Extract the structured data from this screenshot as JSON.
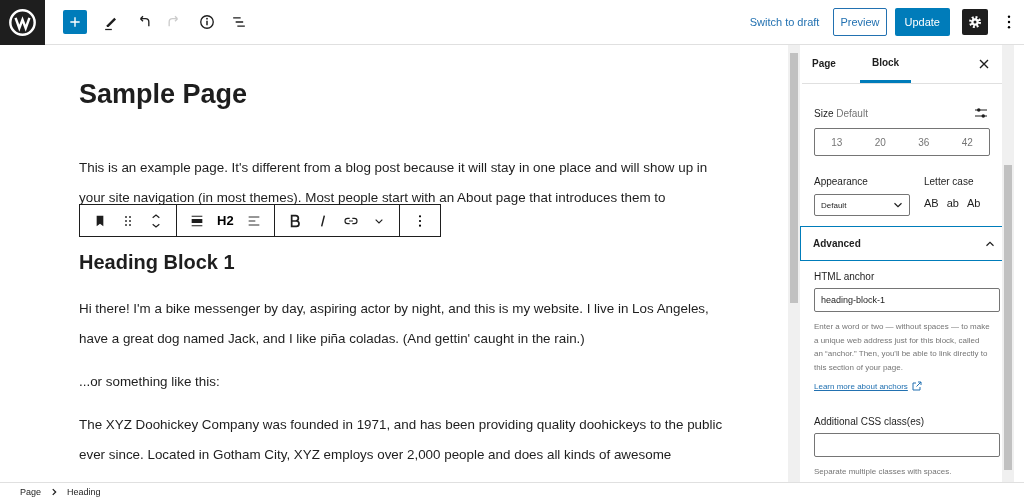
{
  "header": {
    "undo_disabled": false,
    "redo_disabled": true,
    "switch_to_draft": "Switch to draft",
    "preview": "Preview",
    "update": "Update",
    "settings_active": true
  },
  "editor": {
    "title": "Sample Page",
    "blocks": [
      {
        "kind": "paragraph",
        "text": "This is an example page. It's different from a blog post because it will stay in one place and will show up in your site navigation (in most themes). Most people start with an About page that introduces them to"
      },
      {
        "kind": "toolbar",
        "level_label": "H2"
      },
      {
        "kind": "heading",
        "text": "Heading Block 1"
      },
      {
        "kind": "paragraph",
        "text": "Hi there! I'm a bike messenger by day, aspiring actor by night, and this is my website. I live in Los Angeles, have a great dog named Jack, and I like piña coladas. (And gettin' caught in the rain.)"
      },
      {
        "kind": "paragraph",
        "text": "...or something like this:"
      },
      {
        "kind": "paragraph",
        "text": "The XYZ Doohickey Company was founded in 1971, and has been providing quality doohickeys to the public ever since. Located in Gotham City, XYZ employs over 2,000 people and does all kinds of awesome"
      }
    ]
  },
  "sidebar": {
    "tabs": [
      {
        "label": "Page",
        "selected": false
      },
      {
        "label": "Block",
        "selected": true
      }
    ],
    "size": {
      "label": "Size",
      "value": "Default",
      "options": [
        "13",
        "20",
        "36",
        "42"
      ]
    },
    "appearance": {
      "label": "Appearance",
      "value": "Default"
    },
    "letter_case": {
      "label": "Letter case",
      "options": [
        "AB",
        "ab",
        "Ab"
      ]
    },
    "advanced": {
      "title": "Advanced",
      "expanded": true,
      "anchor_label": "HTML anchor",
      "anchor_value": "heading-block-1",
      "anchor_help": "Enter a word or two — without spaces — to make a unique web address just for this block, called an “anchor.” Then, you'll be able to link directly to this section of your page.",
      "anchor_link": "Learn more about anchors",
      "css_label": "Additional CSS class(es)",
      "css_help": "Separate multiple classes with spaces."
    }
  },
  "breadcrumb": [
    "Page",
    "Heading"
  ]
}
